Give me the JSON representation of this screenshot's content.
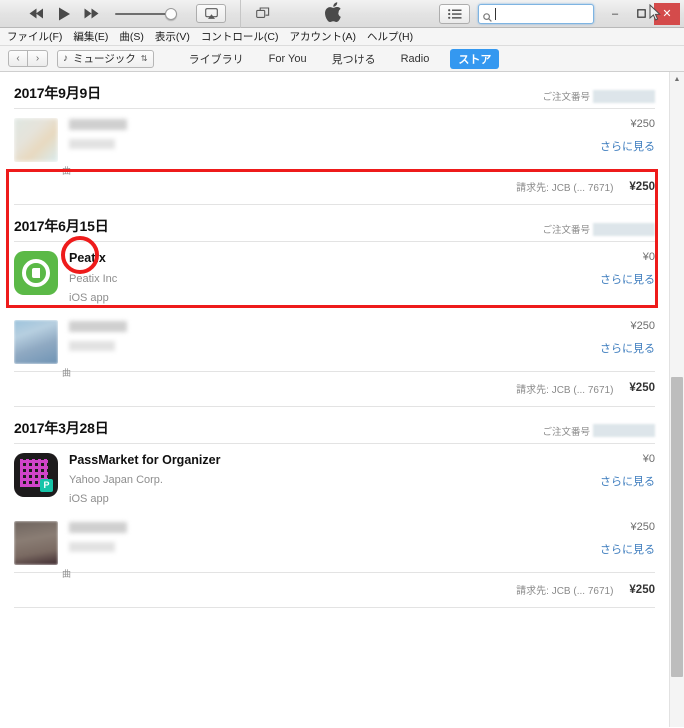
{
  "window": {
    "minimize_label": "–",
    "maximize_label": "❐",
    "close_label": "✕",
    "apple_logo": ""
  },
  "player": {
    "rewind_icon": "rewind-icon",
    "play_icon": "play-icon",
    "forward_icon": "forward-icon",
    "airplay_icon": "airplay-icon",
    "miniplayer_icon": "miniplayer-icon",
    "volume_percent": 92
  },
  "search": {
    "placeholder": "",
    "value": "",
    "icon": "search-icon"
  },
  "list_button": {
    "icon": "list-icon"
  },
  "menubar": {
    "items": [
      {
        "label": "ファイル(F)"
      },
      {
        "label": "編集(E)"
      },
      {
        "label": "曲(S)"
      },
      {
        "label": "表示(V)"
      },
      {
        "label": "コントロール(C)"
      },
      {
        "label": "アカウント(A)"
      },
      {
        "label": "ヘルプ(H)"
      }
    ]
  },
  "navbar": {
    "back_label": "‹",
    "forward_label": "›",
    "library_selector": {
      "note_icon": "music-note-icon",
      "label": "ミュージック",
      "chevron": "⇅"
    },
    "tabs": [
      {
        "label": "ライブラリ",
        "active": false
      },
      {
        "label": "For You",
        "active": false
      },
      {
        "label": "見つける",
        "active": false
      },
      {
        "label": "Radio",
        "active": false
      },
      {
        "label": "ストア",
        "active": true
      }
    ]
  },
  "labels": {
    "order_number": "ご注文番号",
    "more": "さらに見る",
    "song_kind": "曲",
    "ios_app": "iOS app"
  },
  "orders": [
    {
      "date": "2017年9月9日",
      "order_number_redacted": true,
      "items": [
        {
          "art": "blurred-album-art",
          "title_redacted": true,
          "kind": "曲",
          "price": "¥250",
          "more": "さらに見る"
        }
      ],
      "billing": "請求先: JCB (... 7671)",
      "total": "¥250"
    },
    {
      "date": "2017年6月15日",
      "order_number_redacted": true,
      "items": [
        {
          "art": "peatix-app-icon",
          "title": "Peatix",
          "artist": "Peatix Inc",
          "kind": "iOS app",
          "price": "¥0",
          "more": "さらに見る"
        },
        {
          "art": "blurred-album-art",
          "title_redacted": true,
          "kind": "曲",
          "price": "¥250",
          "more": "さらに見る"
        }
      ],
      "billing": "請求先: JCB (... 7671)",
      "total": "¥250"
    },
    {
      "date": "2017年3月28日",
      "order_number_redacted": true,
      "items": [
        {
          "art": "passmarket-app-icon",
          "title": "PassMarket for Organizer",
          "artist": "Yahoo Japan Corp.",
          "kind": "iOS app",
          "price": "¥0",
          "more": "さらに見る"
        },
        {
          "art": "blurred-album-art",
          "title_redacted": true,
          "kind": "曲",
          "price": "¥250",
          "more": "さらに見る"
        }
      ],
      "billing": "請求先: JCB (... 7671)",
      "total": "¥250"
    }
  ],
  "annotations": {
    "highlight_box_color": "#ee1b1b",
    "highlight_circle_color": "#ee1b1b"
  },
  "scrollbar": {
    "up_arrow": "▲"
  }
}
